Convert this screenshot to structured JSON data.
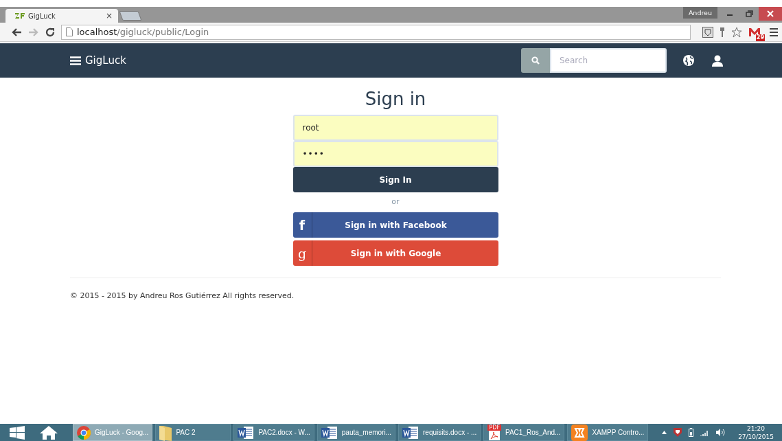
{
  "browser": {
    "tab": {
      "title": "GigLuck",
      "close": "×"
    },
    "user": "Andreu",
    "url_host": "localhost",
    "url_path": "/gigluck/public/Login",
    "mail_badge": "29"
  },
  "navbar": {
    "brand": "GigLuck",
    "search": {
      "placeholder": "Search"
    }
  },
  "form": {
    "title": "Sign in",
    "username": "root",
    "password": "••••",
    "submit": "Sign In",
    "separator": "or",
    "social": [
      {
        "kind": "facebook",
        "glyph": "f",
        "label": "Sign in with Facebook",
        "color": "#3b5998"
      },
      {
        "kind": "google",
        "glyph": "g",
        "label": "Sign in with Google",
        "color": "#dd4b39"
      }
    ]
  },
  "footer": "© 2015 - 2015 by Andreu Ros Gutiérrez All rights reserved.",
  "taskbar": {
    "apps": [
      {
        "kind": "chrome",
        "label": "GigLuck - Goog...",
        "selected": true
      },
      {
        "kind": "folder",
        "label": "PAC 2",
        "selected": false
      },
      {
        "kind": "word",
        "label": "PAC2.docx - W...",
        "selected": false
      },
      {
        "kind": "word",
        "label": "pauta_memori...",
        "selected": false
      },
      {
        "kind": "word",
        "label": "requisits.docx - ...",
        "selected": false
      },
      {
        "kind": "pdf",
        "label": "PAC1_Ros_And...",
        "badge": "PDF",
        "selected": false
      },
      {
        "kind": "xampp",
        "label": "XAMPP Contro...",
        "selected": false
      }
    ],
    "time": "21:20",
    "date": "27/10/2015"
  }
}
